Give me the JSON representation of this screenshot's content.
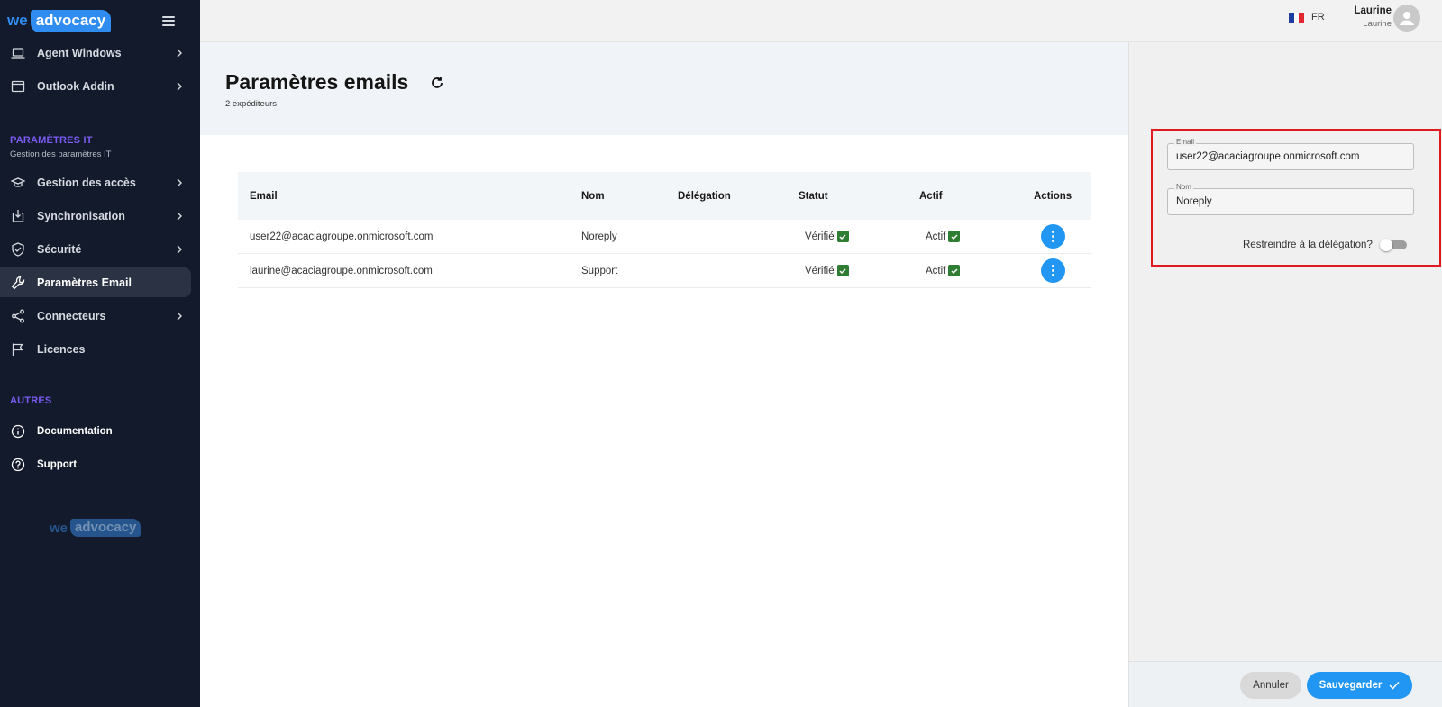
{
  "sidebar": {
    "logo": {
      "we": "we",
      "brand": "advocacy"
    },
    "menu_icon": "hamburger-icon",
    "items_top": [
      {
        "label": "Agent Windows",
        "icon": "laptop-icon"
      },
      {
        "label": "Outlook Addin",
        "icon": "window-icon"
      }
    ],
    "section_it": {
      "title": "PARAMÈTRES IT",
      "subtitle": "Gestion des paramètres IT"
    },
    "items_it": [
      {
        "label": "Gestion des accès",
        "icon": "graduation-cap-icon"
      },
      {
        "label": "Synchronisation",
        "icon": "sync-box-icon"
      },
      {
        "label": "Sécurité",
        "icon": "shield-check-icon"
      },
      {
        "label": "Paramètres Email",
        "icon": "wrench-icon",
        "active": true
      },
      {
        "label": "Connecteurs",
        "icon": "share-icon"
      },
      {
        "label": "Licences",
        "icon": "flag-icon"
      }
    ],
    "section_other": {
      "title": "AUTRES"
    },
    "items_other": [
      {
        "label": "Documentation",
        "icon": "info-icon"
      },
      {
        "label": "Support",
        "icon": "help-icon"
      }
    ],
    "bottom_logo": {
      "we": "we",
      "brand": "advocacy"
    }
  },
  "topbar": {
    "language": "FR",
    "user_name": "Laurine",
    "user_sub": "Laurine"
  },
  "page": {
    "title": "Paramètres emails",
    "subtitle": "2 expéditeurs"
  },
  "table": {
    "headers": {
      "email": "Email",
      "nom": "Nom",
      "delegation": "Délégation",
      "statut": "Statut",
      "actif": "Actif",
      "actions": "Actions"
    },
    "rows": [
      {
        "email": "user22@acaciagroupe.onmicrosoft.com",
        "nom": "Noreply",
        "delegation": "",
        "statut": "Vérifié",
        "actif": "Actif"
      },
      {
        "email": "laurine@acaciagroupe.onmicrosoft.com",
        "nom": "Support",
        "delegation": "",
        "statut": "Vérifié",
        "actif": "Actif"
      }
    ]
  },
  "form": {
    "email_label": "Email",
    "email_value": "user22@acaciagroupe.onmicrosoft.com",
    "nom_label": "Nom",
    "nom_value": "Noreply",
    "restrict_label": "Restreindre à la délégation?",
    "restrict_on": false,
    "cancel": "Annuler",
    "save": "Sauvegarder"
  },
  "colors": {
    "sidebar_bg": "#121a2b",
    "accent": "#2196f3",
    "section": "#7b5cf5",
    "check": "#2e7d32",
    "highlight": "#e0191f"
  }
}
